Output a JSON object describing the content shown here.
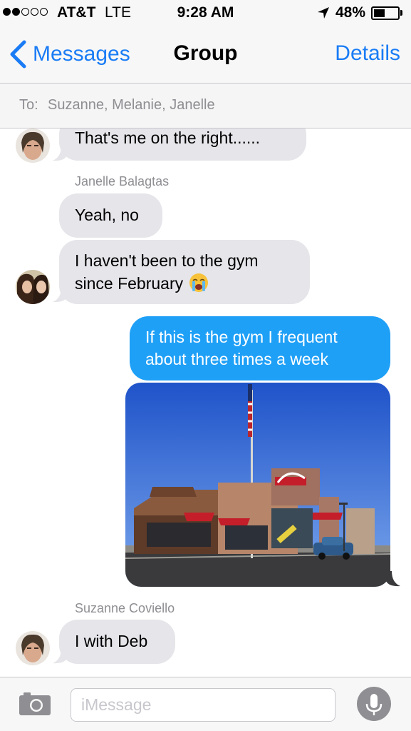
{
  "status_bar": {
    "carrier": "AT&T",
    "network": "LTE",
    "time": "9:28 AM",
    "battery_percent": "48%",
    "battery_level": 0.48,
    "signal_bars_filled": 2,
    "signal_bars_total": 5,
    "icons": [
      "location-arrow-icon",
      "battery-icon"
    ]
  },
  "nav": {
    "back_label": "Messages",
    "title": "Group",
    "details_label": "Details",
    "accent_color": "#1a7cf5"
  },
  "to_bar": {
    "label": "To:",
    "recipients": "Suzanne, Melanie, Janelle"
  },
  "messages": [
    {
      "direction": "incoming",
      "text": "That's me on the right......"
    },
    {
      "direction": "incoming",
      "sender": "Janelle Balagtas",
      "text": "Yeah, no"
    },
    {
      "direction": "incoming",
      "text_line1": "I haven't been to the gym",
      "text_line2": "since February",
      "emoji": "crying-face-icon"
    },
    {
      "direction": "outgoing",
      "text_line1": "If this is the gym I frequent",
      "text_line2": "about three times a week"
    },
    {
      "direction": "outgoing",
      "type": "photo",
      "icon": "photo-fast-food-restaurant"
    },
    {
      "direction": "incoming",
      "sender": "Suzanne Coviello",
      "text": "I with Deb"
    }
  ],
  "colors": {
    "incoming_bubble": "#e5e5ea",
    "outgoing_bubble": "#1fa0f7"
  },
  "input_bar": {
    "placeholder": "iMessage",
    "value": "",
    "icons": [
      "camera-icon",
      "microphone-icon"
    ]
  }
}
